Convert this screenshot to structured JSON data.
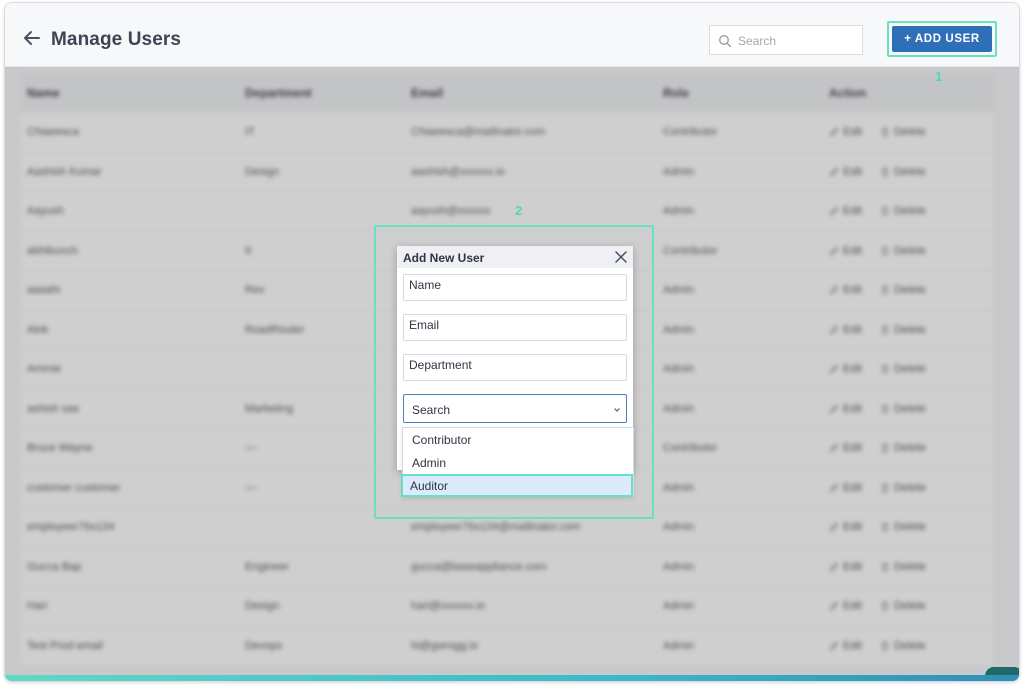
{
  "header": {
    "title": "Manage Users",
    "search_placeholder": "Search",
    "add_user_label": "+ ADD USER"
  },
  "steps": {
    "step1": "1",
    "step2": "2"
  },
  "table": {
    "columns": [
      "Name",
      "Department",
      "Email",
      "Role",
      "Action"
    ],
    "action_edit": "Edit",
    "action_delete": "Delete",
    "rows": [
      [
        "Chiaeesca",
        "IT",
        "Chiaeesca@mailinator.com",
        "Contributor"
      ],
      [
        "Aashish Kumar",
        "Design",
        "aashish@xxxxxx.io",
        "Admin"
      ],
      [
        "Aayush",
        "",
        "aayush@xxxxxx",
        "Admin"
      ],
      [
        "abhibunch",
        "It",
        "",
        "Contributor"
      ],
      [
        "aaaahi",
        "Rev",
        "",
        "Admin"
      ],
      [
        "Alok",
        "RoadRouter",
        "",
        "Admin"
      ],
      [
        "Ammie",
        "",
        "",
        "Admin"
      ],
      [
        "ashish sas",
        "Marketing",
        "",
        "Admin"
      ],
      [
        "Bruce Wayne",
        "—",
        "",
        "Contributor"
      ],
      [
        "customer customer",
        "—",
        "",
        "Admin"
      ],
      [
        "employeer76x134",
        "",
        "employeer76x134@mailinator.com",
        "Admin"
      ],
      [
        "Gucca Bap",
        "Engineer",
        "gucca@baseappliance.com",
        "Admin"
      ],
      [
        "Hari",
        "Design",
        "hari@xxxxxx.io",
        "Admin"
      ],
      [
        "Test Prod email",
        "Devops",
        "hi@gwrsgg.io",
        "Admin"
      ]
    ]
  },
  "modal": {
    "title": "Add New User",
    "name_placeholder": "Name",
    "email_placeholder": "Email",
    "department_placeholder": "Department",
    "role_select_value": "Search",
    "role_options": [
      "Contributor",
      "Admin",
      "Auditor"
    ],
    "selected_option": "Auditor"
  },
  "colors": {
    "accent": "#2f6fb7",
    "highlight": "#67e0c4",
    "selected_option_bg": "#dcebfb"
  }
}
